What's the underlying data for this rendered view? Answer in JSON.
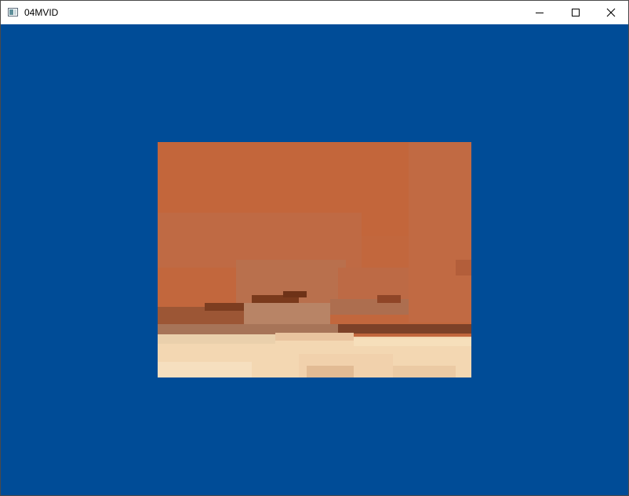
{
  "window": {
    "title": "04MVID",
    "icons": {
      "app": "app-window-icon",
      "minimize": "minimize-icon",
      "maximize": "maximize-icon",
      "close": "close-icon"
    }
  },
  "colors": {
    "client_background": "#004c97",
    "video_sky": "#c2673d",
    "video_sand": "#f3d7b2"
  }
}
